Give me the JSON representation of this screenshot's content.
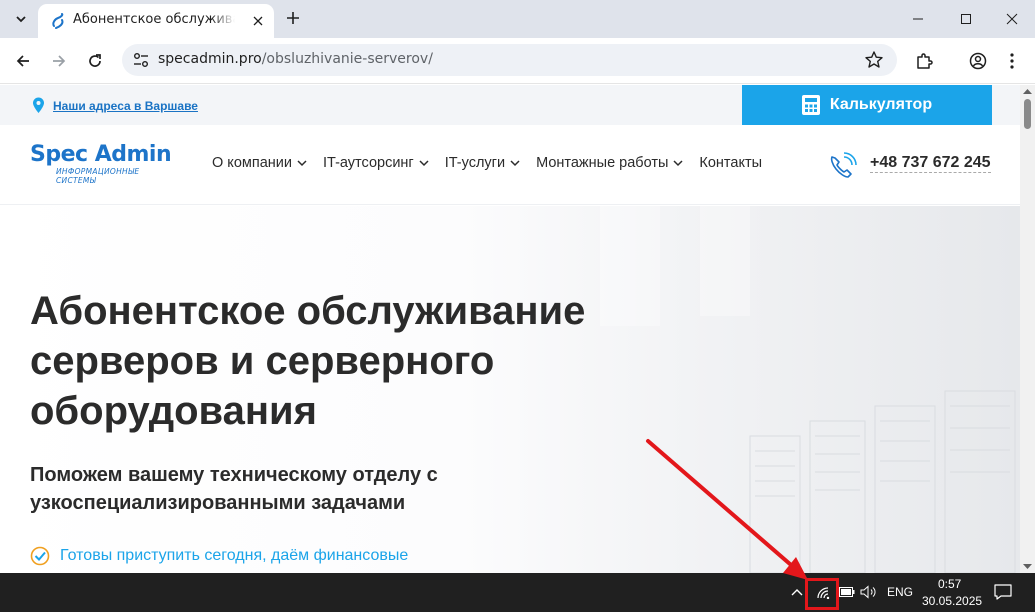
{
  "browser": {
    "tab": {
      "title": "Абонентское обслуживание серверов"
    },
    "url": {
      "host": "specadmin.pro",
      "path": "/obsluzhivanie-serverov/"
    }
  },
  "page": {
    "top_strip": {
      "address_link": "Наши адреса в Варшаве",
      "calculator_button": "Калькулятор"
    },
    "logo": {
      "main": "Spec Admin",
      "sub": "ИНФОРМАЦИОННЫЕ СИСТЕМЫ"
    },
    "nav": {
      "items": [
        {
          "label": "О компании",
          "dropdown": true
        },
        {
          "label": "IT-аутсорсинг",
          "dropdown": true
        },
        {
          "label": "IT-услуги",
          "dropdown": true
        },
        {
          "label": "Монтажные работы",
          "dropdown": true
        },
        {
          "label": "Контакты",
          "dropdown": false
        }
      ],
      "phone": "+48 737 672 245"
    },
    "hero": {
      "title": "Абонентское обслуживание серверов и серверного оборудования",
      "subtitle": "Поможем вашему техническому отделу с узкоспециализированными задачами",
      "feature": "Готовы приступить сегодня, даём финансовые"
    }
  },
  "taskbar": {
    "language": "ENG",
    "time": "0:57",
    "date": "30.05.2025"
  },
  "colors": {
    "accent": "#1ba4e9",
    "brand": "#1d74c9",
    "annotation": "#e3171b",
    "taskbar": "#202020"
  }
}
